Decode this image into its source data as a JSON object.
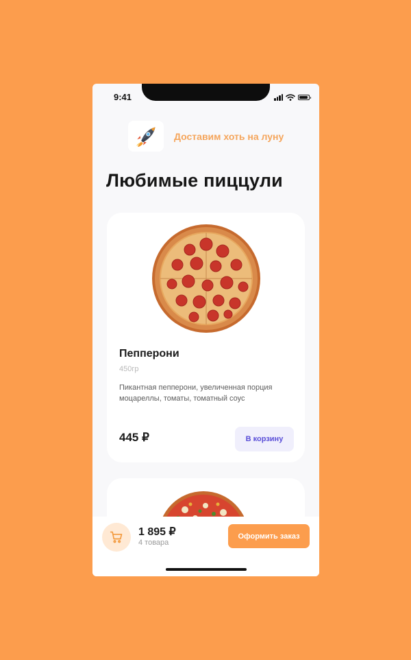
{
  "status_bar": {
    "time": "9:41"
  },
  "header": {
    "slogan": "Доставим хоть на луну",
    "logo_icon": "rocket-icon"
  },
  "page": {
    "title": "Любимые пиццули"
  },
  "products": [
    {
      "name": "Пепперони",
      "weight": "450гр",
      "description": "Пикантная пепперони, увеличенная порция моцареллы, томаты, томатный соус",
      "price": "445 ₽",
      "add_label": "В корзину"
    }
  ],
  "cart": {
    "total": "1 895 ₽",
    "count": "4 товара",
    "checkout_label": "Оформить заказ",
    "icon": "cart-icon"
  },
  "colors": {
    "background": "#FC9D4D",
    "accent": "#FC9D4D",
    "slogan": "#F5A55B",
    "add_button_bg": "#F0EFFC",
    "add_button_text": "#5A4FD8"
  }
}
